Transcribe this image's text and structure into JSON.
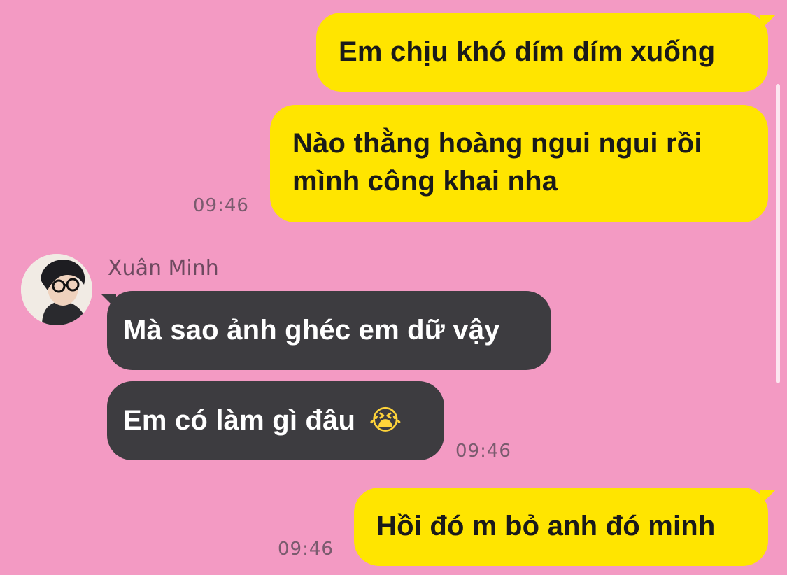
{
  "messages": [
    {
      "id": 1,
      "direction": "outgoing",
      "text": "Em chịu khó dím dím xuống",
      "time": ""
    },
    {
      "id": 2,
      "direction": "outgoing",
      "lines": [
        "Nào thằng hoàng ngui ngui rồi",
        "mình công khai nha"
      ],
      "time": "09:46"
    },
    {
      "id": 3,
      "direction": "incoming",
      "sender": "Xuân Minh",
      "text": "Mà sao ảnh ghéc em dữ vậy",
      "time": ""
    },
    {
      "id": 4,
      "direction": "incoming",
      "text": "Em có làm gì đâu",
      "emoji": "😭",
      "time": "09:46"
    },
    {
      "id": 5,
      "direction": "outgoing",
      "text": "Hồi đó m bỏ anh đó minh",
      "time": "09:46"
    }
  ],
  "colors": {
    "background": "#f39ac3",
    "outgoing_bubble": "#ffe500",
    "incoming_bubble": "#3d3c40",
    "timestamp": "#7a5b6e"
  }
}
